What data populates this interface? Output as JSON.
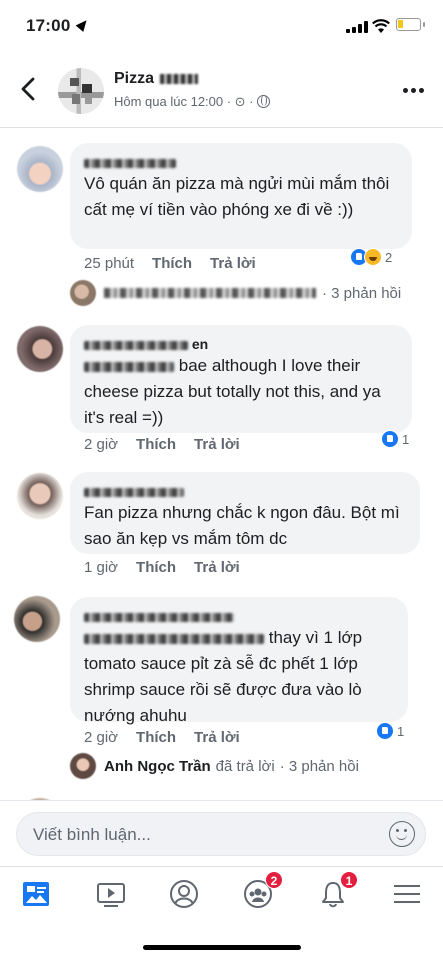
{
  "status_bar": {
    "time": "17:00"
  },
  "header": {
    "page_name": "Pizza",
    "post_time": "Hôm qua lúc 12:00 · ⊙ ·"
  },
  "comments": [
    {
      "text": "Vô quán ăn pizza mà ngửi mùi mắm thôi cất mẹ ví tiền vào phóng xe đi về :))",
      "time": "25 phút",
      "like": "Thích",
      "reply": "Trả lời",
      "reaction_count": "2",
      "replies_label": "· 3 phản hồi"
    },
    {
      "name_tail": "en",
      "text_prefix": "bae although I love their",
      "text": "cheese pizza but totally not this, and ya it's real =))",
      "time": "2 giờ",
      "like": "Thích",
      "reply": "Trả lời",
      "reaction_count": "1"
    },
    {
      "text": "Fan pizza nhưng chắc k ngon đâu. Bột mì sao ăn kẹp vs mắm tôm dc",
      "time": "1 giờ",
      "like": "Thích",
      "reply": "Trả lời"
    },
    {
      "text_prefix": "thay vì 1 lớp",
      "text": "tomato sauce pỉt zà sễ đc phết 1 lớp shrimp sauce rồi sẽ được đưa vào lò nướng ahuhu",
      "time": "2 giờ",
      "like": "Thích",
      "reply": "Trả lời",
      "reaction_count": "1",
      "reply_author": "Anh Ngọc Trần",
      "reply_action": "đã trả lời",
      "replies_label": "· 3 phản hồi"
    }
  ],
  "composer": {
    "placeholder": "Viết bình luận..."
  },
  "tabbar": {
    "badges": {
      "groups": "2",
      "notifications": "1"
    }
  },
  "colors": {
    "accent": "#1877f2",
    "badge": "#e41e3f",
    "bubble": "#f2f3f5"
  }
}
